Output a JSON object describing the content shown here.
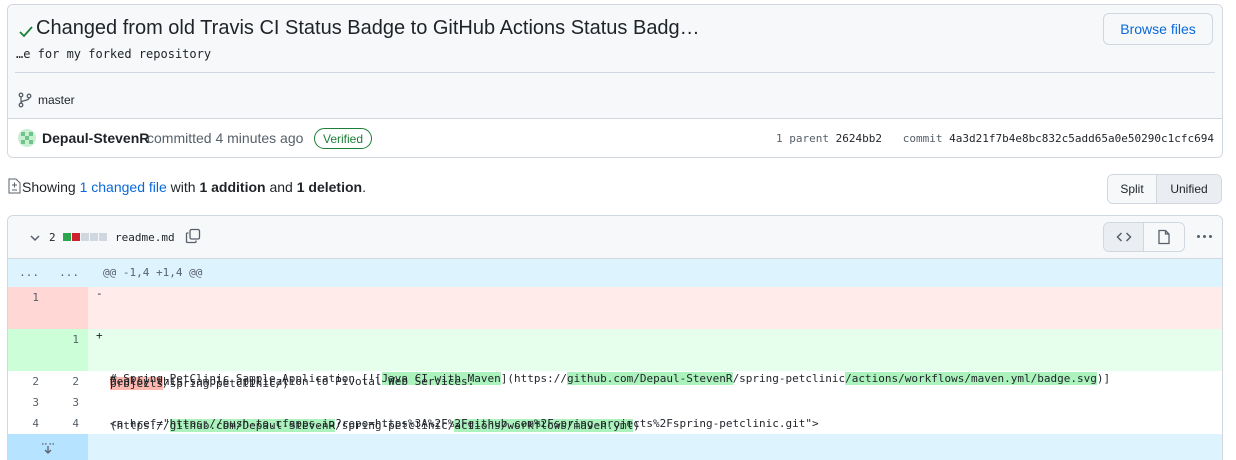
{
  "commit": {
    "title": "Changed from old Travis CI Status Badge to GitHub Actions Status Badg…",
    "description": "…e for my forked repository",
    "browse_files_label": "Browse files",
    "branch": "master",
    "author": "Depaul-StevenR",
    "committed_text": "committed 4 minutes ago",
    "verified_label": "Verified",
    "parent_label": "1 parent",
    "parent_sha": "2624bb2",
    "commit_label": "commit",
    "commit_sha": "4a3d21f7b4e8bc832c5add65a0e50290c1cfc694"
  },
  "summary": {
    "prefix": "Showing",
    "changed_link": "1 changed file",
    "with": "with",
    "additions": "1 addition",
    "and": "and",
    "deletions": "1 deletion",
    "suffix": "."
  },
  "view_toggle": {
    "split": "Split",
    "unified": "Unified"
  },
  "file": {
    "changes": "2",
    "name": "readme.md",
    "diffstat": [
      "add",
      "del",
      "neutral",
      "neutral",
      "neutral"
    ]
  },
  "colors": {
    "add": "#2da44e",
    "del": "#cf222e",
    "neutral": "#d0d7de",
    "link": "#0969da"
  },
  "diff": {
    "hunk_left": "...",
    "hunk_right": "...",
    "hunk_header": "@@ -1,4 +1,4 @@",
    "del_line_num": "1",
    "del_segments": [
      {
        "t": "# Spring PetClinic Sample Application [![",
        "h": false
      },
      {
        "t": "Build Status",
        "h": true
      },
      {
        "t": "](https://",
        "h": false
      },
      {
        "t": "travis-ci.org/spring-projects",
        "h": true
      },
      {
        "t": "/spring-petclinic",
        "h": false
      },
      {
        "t": ".png?branch=master",
        "h": true
      },
      {
        "t": ")](https://",
        "h": false
      },
      {
        "t": "travis-ci.org/spring-",
        "h": true
      }
    ],
    "del_segments_2": [
      {
        "t": "projects",
        "h": true
      },
      {
        "t": "/spring-petclinic/)",
        "h": false
      }
    ],
    "add_line_num": "1",
    "add_segments": [
      {
        "t": "# Spring PetClinic Sample Application [![",
        "h": false
      },
      {
        "t": "Java CI with Maven",
        "h": true
      },
      {
        "t": "](https://",
        "h": false
      },
      {
        "t": "github.com/Depaul-StevenR",
        "h": true
      },
      {
        "t": "/spring-petclinic",
        "h": false
      },
      {
        "t": "/actions/workflows/maven.yml/badge.svg",
        "h": true
      },
      {
        "t": ")]",
        "h": false
      }
    ],
    "add_segments_2": [
      {
        "t": "(https://",
        "h": false
      },
      {
        "t": "github.com/Depaul-StevenR",
        "h": true
      },
      {
        "t": "/spring-petclinic/",
        "h": false
      },
      {
        "t": "actions/workflows/maven.yml",
        "h": true
      },
      {
        "t": ")",
        "h": false
      }
    ],
    "context": [
      {
        "left": "2",
        "right": "2",
        "text": "Deploy this sample application to Pivotal Web Services:"
      },
      {
        "left": "3",
        "right": "3",
        "text": ""
      },
      {
        "left": "4",
        "right": "4",
        "text": "<a href=\"https://push-to.cfapps.io?repo=https%3A%2F%2Fgithub.com%2Fspring-projects%2Fspring-petclinic.git\">"
      }
    ]
  }
}
